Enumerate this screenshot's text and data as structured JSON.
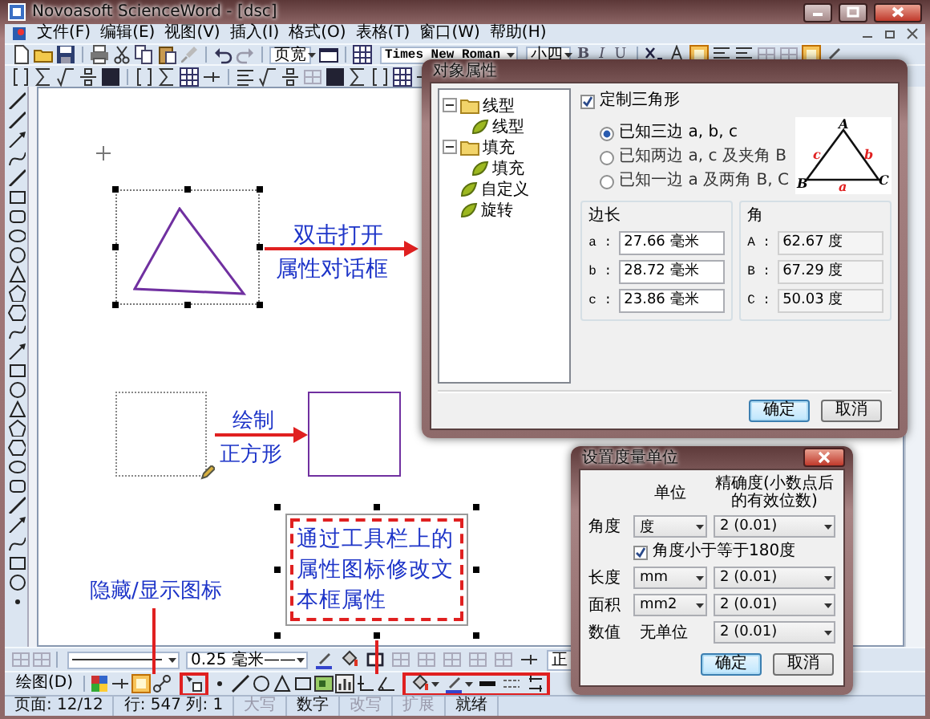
{
  "window": {
    "title": "Novoasoft ScienceWord - [dsc]"
  },
  "menu": [
    "文件(F)",
    "编辑(E)",
    "视图(V)",
    "插入(I)",
    "格式(O)",
    "表格(T)",
    "窗口(W)",
    "帮助(H)"
  ],
  "toolbar": {
    "zoom": "页宽",
    "font": "Times New Roman",
    "size": "小四",
    "format_buttons": [
      "B",
      "I",
      "U"
    ]
  },
  "canvas": {
    "arrow_labels": [
      {
        "above": "双击打开",
        "below": "属性对话框"
      },
      {
        "above": "绘制",
        "below": "正方形"
      }
    ],
    "textbox": "通过工具栏上的属性图标修改文本框属性",
    "callout": "隐藏/显示图标"
  },
  "drawing_toolbar": {
    "line_width": "0.25 毫米——",
    "style": "正",
    "menu_button": "绘图(D)"
  },
  "status_bar": [
    {
      "text": "页面: 12/12",
      "disabled": false
    },
    {
      "text": "行: 547 列: 1",
      "disabled": false
    },
    {
      "text": "大写",
      "disabled": true
    },
    {
      "text": "数字",
      "disabled": false
    },
    {
      "text": "改写",
      "disabled": true
    },
    {
      "text": "扩展",
      "disabled": true
    },
    {
      "text": "就绪",
      "disabled": false
    }
  ],
  "properties_dialog": {
    "title": "对象属性",
    "tree": [
      {
        "label": "线型",
        "expanded": true,
        "children": [
          {
            "label": "线型"
          }
        ]
      },
      {
        "label": "填充",
        "expanded": true,
        "children": [
          {
            "label": "填充"
          }
        ]
      },
      {
        "label": "自定义"
      },
      {
        "label": "旋转"
      }
    ],
    "custom_triangle": {
      "label": "定制三角形",
      "checked": true
    },
    "modes": [
      {
        "label": "已知三边 a, b, c",
        "selected": true
      },
      {
        "label": "已知两边 a, c 及夹角 B",
        "selected": false
      },
      {
        "label": "已知一边 a 及两角 B, C",
        "selected": false
      }
    ],
    "figure": {
      "vertices": [
        "A",
        "B",
        "C"
      ],
      "sides": [
        "a",
        "b",
        "c"
      ]
    },
    "groups": [
      {
        "title": "边长",
        "readonly": false,
        "rows": [
          {
            "name": "a :",
            "value": "27.66 毫米"
          },
          {
            "name": "b :",
            "value": "28.72 毫米"
          },
          {
            "name": "c :",
            "value": "23.86 毫米"
          }
        ]
      },
      {
        "title": "角",
        "readonly": true,
        "rows": [
          {
            "name": "A :",
            "value": "62.67 度"
          },
          {
            "name": "B :",
            "value": "67.29 度"
          },
          {
            "name": "C :",
            "value": "50.03 度"
          }
        ]
      }
    ],
    "buttons": [
      {
        "label": "确定",
        "default": true
      },
      {
        "label": "取消",
        "default": false
      }
    ]
  },
  "units_dialog": {
    "title": "设置度量单位",
    "columns": [
      "单位",
      "精确度(小数点后的有效位数)"
    ],
    "rows": [
      {
        "kind": "select",
        "label": "角度",
        "unit": "度",
        "precision": "2 (0.01)"
      },
      {
        "kind": "checkbox",
        "text": "角度小于等于180度",
        "checked": true
      },
      {
        "kind": "select",
        "label": "长度",
        "unit": "mm",
        "precision": "2 (0.01)"
      },
      {
        "kind": "select",
        "label": "面积",
        "unit": "mm2",
        "precision": "2 (0.01)"
      },
      {
        "kind": "fixed",
        "label": "数值",
        "unit": "无单位",
        "precision": "2 (0.01)"
      }
    ],
    "buttons": [
      {
        "label": "确定",
        "default": true
      },
      {
        "label": "取消",
        "default": false
      }
    ]
  }
}
